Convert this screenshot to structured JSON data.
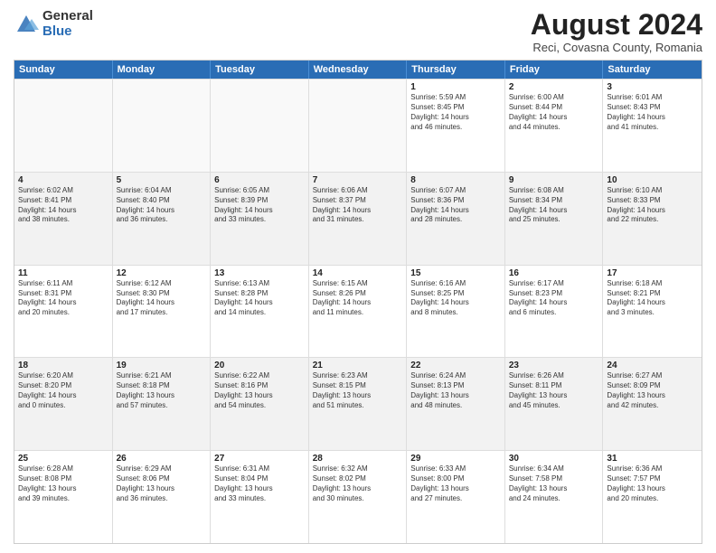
{
  "logo": {
    "general": "General",
    "blue": "Blue"
  },
  "title": {
    "month_year": "August 2024",
    "location": "Reci, Covasna County, Romania"
  },
  "header_days": [
    "Sunday",
    "Monday",
    "Tuesday",
    "Wednesday",
    "Thursday",
    "Friday",
    "Saturday"
  ],
  "weeks": [
    [
      {
        "day": "",
        "text": ""
      },
      {
        "day": "",
        "text": ""
      },
      {
        "day": "",
        "text": ""
      },
      {
        "day": "",
        "text": ""
      },
      {
        "day": "1",
        "text": "Sunrise: 5:59 AM\nSunset: 8:45 PM\nDaylight: 14 hours\nand 46 minutes."
      },
      {
        "day": "2",
        "text": "Sunrise: 6:00 AM\nSunset: 8:44 PM\nDaylight: 14 hours\nand 44 minutes."
      },
      {
        "day": "3",
        "text": "Sunrise: 6:01 AM\nSunset: 8:43 PM\nDaylight: 14 hours\nand 41 minutes."
      }
    ],
    [
      {
        "day": "4",
        "text": "Sunrise: 6:02 AM\nSunset: 8:41 PM\nDaylight: 14 hours\nand 38 minutes."
      },
      {
        "day": "5",
        "text": "Sunrise: 6:04 AM\nSunset: 8:40 PM\nDaylight: 14 hours\nand 36 minutes."
      },
      {
        "day": "6",
        "text": "Sunrise: 6:05 AM\nSunset: 8:39 PM\nDaylight: 14 hours\nand 33 minutes."
      },
      {
        "day": "7",
        "text": "Sunrise: 6:06 AM\nSunset: 8:37 PM\nDaylight: 14 hours\nand 31 minutes."
      },
      {
        "day": "8",
        "text": "Sunrise: 6:07 AM\nSunset: 8:36 PM\nDaylight: 14 hours\nand 28 minutes."
      },
      {
        "day": "9",
        "text": "Sunrise: 6:08 AM\nSunset: 8:34 PM\nDaylight: 14 hours\nand 25 minutes."
      },
      {
        "day": "10",
        "text": "Sunrise: 6:10 AM\nSunset: 8:33 PM\nDaylight: 14 hours\nand 22 minutes."
      }
    ],
    [
      {
        "day": "11",
        "text": "Sunrise: 6:11 AM\nSunset: 8:31 PM\nDaylight: 14 hours\nand 20 minutes."
      },
      {
        "day": "12",
        "text": "Sunrise: 6:12 AM\nSunset: 8:30 PM\nDaylight: 14 hours\nand 17 minutes."
      },
      {
        "day": "13",
        "text": "Sunrise: 6:13 AM\nSunset: 8:28 PM\nDaylight: 14 hours\nand 14 minutes."
      },
      {
        "day": "14",
        "text": "Sunrise: 6:15 AM\nSunset: 8:26 PM\nDaylight: 14 hours\nand 11 minutes."
      },
      {
        "day": "15",
        "text": "Sunrise: 6:16 AM\nSunset: 8:25 PM\nDaylight: 14 hours\nand 8 minutes."
      },
      {
        "day": "16",
        "text": "Sunrise: 6:17 AM\nSunset: 8:23 PM\nDaylight: 14 hours\nand 6 minutes."
      },
      {
        "day": "17",
        "text": "Sunrise: 6:18 AM\nSunset: 8:21 PM\nDaylight: 14 hours\nand 3 minutes."
      }
    ],
    [
      {
        "day": "18",
        "text": "Sunrise: 6:20 AM\nSunset: 8:20 PM\nDaylight: 14 hours\nand 0 minutes."
      },
      {
        "day": "19",
        "text": "Sunrise: 6:21 AM\nSunset: 8:18 PM\nDaylight: 13 hours\nand 57 minutes."
      },
      {
        "day": "20",
        "text": "Sunrise: 6:22 AM\nSunset: 8:16 PM\nDaylight: 13 hours\nand 54 minutes."
      },
      {
        "day": "21",
        "text": "Sunrise: 6:23 AM\nSunset: 8:15 PM\nDaylight: 13 hours\nand 51 minutes."
      },
      {
        "day": "22",
        "text": "Sunrise: 6:24 AM\nSunset: 8:13 PM\nDaylight: 13 hours\nand 48 minutes."
      },
      {
        "day": "23",
        "text": "Sunrise: 6:26 AM\nSunset: 8:11 PM\nDaylight: 13 hours\nand 45 minutes."
      },
      {
        "day": "24",
        "text": "Sunrise: 6:27 AM\nSunset: 8:09 PM\nDaylight: 13 hours\nand 42 minutes."
      }
    ],
    [
      {
        "day": "25",
        "text": "Sunrise: 6:28 AM\nSunset: 8:08 PM\nDaylight: 13 hours\nand 39 minutes."
      },
      {
        "day": "26",
        "text": "Sunrise: 6:29 AM\nSunset: 8:06 PM\nDaylight: 13 hours\nand 36 minutes."
      },
      {
        "day": "27",
        "text": "Sunrise: 6:31 AM\nSunset: 8:04 PM\nDaylight: 13 hours\nand 33 minutes."
      },
      {
        "day": "28",
        "text": "Sunrise: 6:32 AM\nSunset: 8:02 PM\nDaylight: 13 hours\nand 30 minutes."
      },
      {
        "day": "29",
        "text": "Sunrise: 6:33 AM\nSunset: 8:00 PM\nDaylight: 13 hours\nand 27 minutes."
      },
      {
        "day": "30",
        "text": "Sunrise: 6:34 AM\nSunset: 7:58 PM\nDaylight: 13 hours\nand 24 minutes."
      },
      {
        "day": "31",
        "text": "Sunrise: 6:36 AM\nSunset: 7:57 PM\nDaylight: 13 hours\nand 20 minutes."
      }
    ]
  ]
}
